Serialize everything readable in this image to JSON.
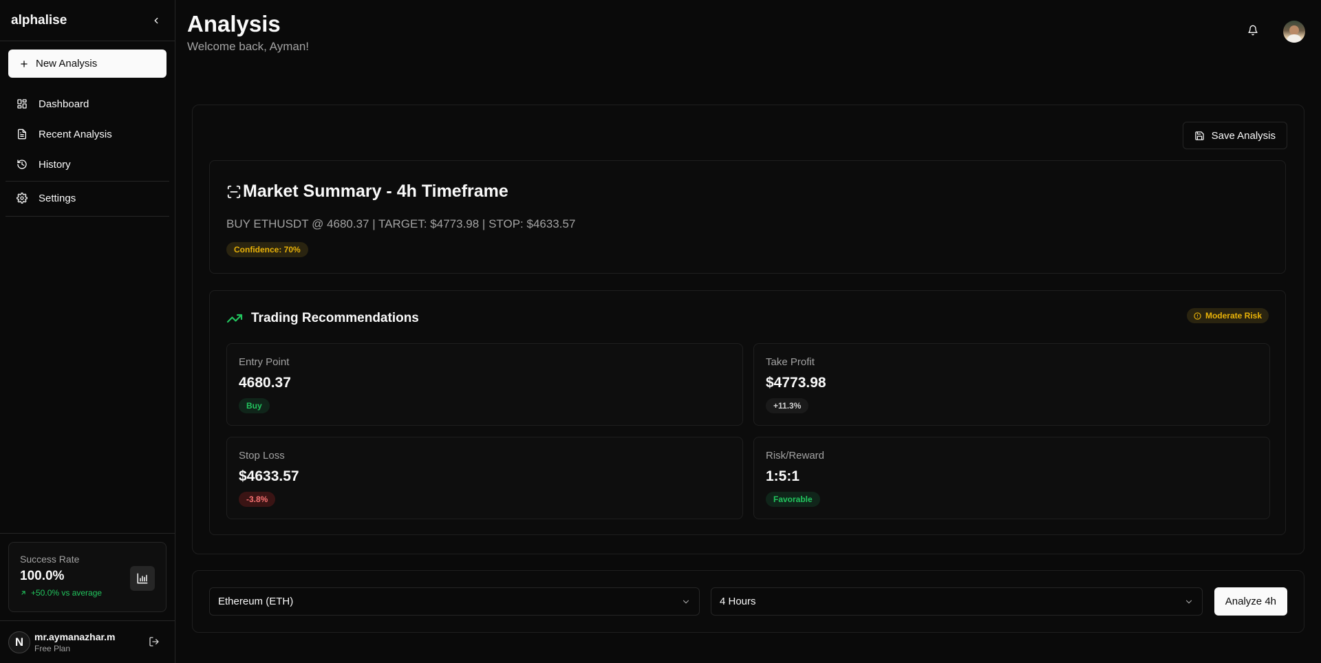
{
  "sidebar": {
    "brand": "alphalise",
    "new_button": "New Analysis",
    "nav": [
      {
        "label": "Dashboard",
        "icon": "grid-icon"
      },
      {
        "label": "Recent Analysis",
        "icon": "file-icon"
      },
      {
        "label": "History",
        "icon": "history-icon"
      },
      {
        "label": "Settings",
        "icon": "gear-icon"
      }
    ],
    "stat": {
      "label": "Success Rate",
      "value": "100.0%",
      "delta": "+50.0% vs average"
    },
    "user": {
      "initial": "N",
      "name": "mr.aymanazhar.m",
      "plan": "Free Plan"
    }
  },
  "header": {
    "title": "Analysis",
    "subtitle": "Welcome back, Ayman!"
  },
  "panel": {
    "save_label": "Save Analysis",
    "summary": {
      "title": "Market Summary - 4h Timeframe",
      "line": "BUY ETHUSDT @ 4680.37 | TARGET: $4773.98 | STOP: $4633.57",
      "confidence": "Confidence: 70%"
    },
    "recs": {
      "title": "Trading Recommendations",
      "risk": "Moderate Risk",
      "cards": [
        {
          "label": "Entry Point",
          "value": "4680.37",
          "badge": "Buy"
        },
        {
          "label": "Take Profit",
          "value": "$4773.98",
          "badge": "+11.3%"
        },
        {
          "label": "Stop Loss",
          "value": "$4633.57",
          "badge": "-3.8%"
        },
        {
          "label": "Risk/Reward",
          "value": "1:5:1",
          "badge": "Favorable"
        }
      ]
    }
  },
  "controls": {
    "asset": "Ethereum (ETH)",
    "timeframe": "4 Hours",
    "analyze_label": "Analyze 4h"
  },
  "colors": {
    "background": "#0a0a0a",
    "accent_green": "#22c55e",
    "accent_yellow": "#eab308",
    "accent_red": "#f87171"
  }
}
